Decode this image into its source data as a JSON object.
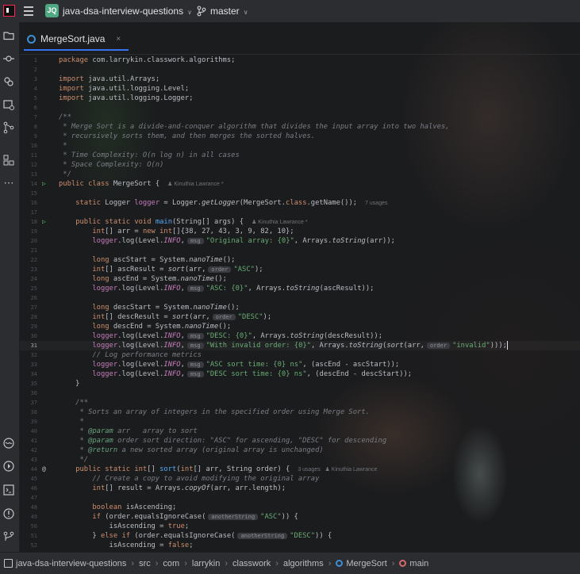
{
  "titlebar": {
    "project_badge": "JQ",
    "project_name": "java-dsa-interview-questions",
    "branch": "master"
  },
  "tab": {
    "label": "MergeSort.java",
    "close": "×"
  },
  "lines": [
    {
      "n": "1",
      "t": [
        [
          "k",
          "package "
        ],
        [
          "",
          "com.larrykin.classwork.algorithms;"
        ]
      ]
    },
    {
      "n": "2",
      "t": []
    },
    {
      "n": "3",
      "t": [
        [
          "k",
          "import "
        ],
        [
          "",
          "java.util.Arrays;"
        ]
      ]
    },
    {
      "n": "4",
      "t": [
        [
          "k",
          "import "
        ],
        [
          "",
          "java.util.logging.Level;"
        ]
      ]
    },
    {
      "n": "5",
      "t": [
        [
          "k",
          "import "
        ],
        [
          "",
          "java.util.logging.Logger;"
        ]
      ]
    },
    {
      "n": "6",
      "t": []
    },
    {
      "n": "7",
      "t": [
        [
          "c",
          "/**"
        ]
      ]
    },
    {
      "n": "8",
      "t": [
        [
          "c",
          " * Merge Sort is a divide-and-conquer algorithm that divides the input array into two halves,"
        ]
      ]
    },
    {
      "n": "9",
      "t": [
        [
          "c",
          " * recursively sorts them, and then merges the sorted halves."
        ]
      ]
    },
    {
      "n": "10",
      "t": [
        [
          "c",
          " * "
        ]
      ]
    },
    {
      "n": "11",
      "t": [
        [
          "c",
          " * Time Complexity: O(n log n) in all cases"
        ]
      ]
    },
    {
      "n": "12",
      "t": [
        [
          "c",
          " * Space Complexity: O(n)"
        ]
      ]
    },
    {
      "n": "13",
      "t": [
        [
          "c",
          " */"
        ]
      ]
    },
    {
      "n": "14",
      "g": "▷",
      "t": [
        [
          "k",
          "public class "
        ],
        [
          "",
          "MergeSort {"
        ],
        [
          "anno",
          "♟ Kinuthia Lawrance *"
        ]
      ]
    },
    {
      "n": "15",
      "t": []
    },
    {
      "n": "16",
      "t": [
        [
          "",
          "    "
        ],
        [
          "k",
          "static "
        ],
        [
          "",
          "Logger "
        ],
        [
          "fi",
          "logger"
        ],
        [
          "",
          " = Logger."
        ],
        [
          "st",
          "getLogger"
        ],
        [
          "",
          "(MergeSort."
        ],
        [
          "k",
          "class"
        ],
        [
          "",
          ".getName());"
        ],
        [
          "anno",
          "7 usages"
        ]
      ]
    },
    {
      "n": "17",
      "t": []
    },
    {
      "n": "18",
      "g": "▷",
      "t": [
        [
          "",
          "    "
        ],
        [
          "k",
          "public static void "
        ],
        [
          "f",
          "main"
        ],
        [
          "",
          "(String[] args) {"
        ],
        [
          "anno",
          "♟ Kinuthia Lawrance *"
        ]
      ]
    },
    {
      "n": "19",
      "t": [
        [
          "",
          "        "
        ],
        [
          "k",
          "int"
        ],
        [
          "",
          "[] arr = "
        ],
        [
          "k",
          "new int"
        ],
        [
          "",
          "[]{38, 27, 43, 3, 9, 82, 10};"
        ]
      ]
    },
    {
      "n": "20",
      "t": [
        [
          "",
          "        "
        ],
        [
          "fi",
          "logger"
        ],
        [
          "",
          ".log(Level."
        ],
        [
          "fi st",
          "INFO"
        ],
        [
          ",",
          ""
        ],
        [
          "hint",
          "msg"
        ],
        [
          "s",
          "\"Original array: {0}\""
        ],
        [
          "",
          ", Arrays."
        ],
        [
          "st",
          "toString"
        ],
        [
          "",
          "(arr));"
        ]
      ]
    },
    {
      "n": "21",
      "t": []
    },
    {
      "n": "22",
      "t": [
        [
          "",
          "        "
        ],
        [
          "k",
          "long "
        ],
        [
          "",
          "ascStart = System."
        ],
        [
          "st",
          "nanoTime"
        ],
        [
          "",
          "();"
        ]
      ]
    },
    {
      "n": "23",
      "t": [
        [
          "",
          "        "
        ],
        [
          "k",
          "int"
        ],
        [
          "",
          "[] ascResult = "
        ],
        [
          "st",
          "sort"
        ],
        [
          "",
          "(arr,"
        ],
        [
          "hint",
          "order"
        ],
        [
          "s",
          "\"ASC\""
        ],
        [
          "",
          ");"
        ]
      ]
    },
    {
      "n": "24",
      "t": [
        [
          "",
          "        "
        ],
        [
          "k",
          "long "
        ],
        [
          "",
          "ascEnd = System."
        ],
        [
          "st",
          "nanoTime"
        ],
        [
          "",
          "();"
        ]
      ]
    },
    {
      "n": "25",
      "t": [
        [
          "",
          "        "
        ],
        [
          "fi",
          "logger"
        ],
        [
          "",
          ".log(Level."
        ],
        [
          "fi st",
          "INFO"
        ],
        [
          ",",
          ""
        ],
        [
          "hint",
          "msg"
        ],
        [
          "s",
          "\"ASC: {0}\""
        ],
        [
          "",
          ", Arrays."
        ],
        [
          "st",
          "toString"
        ],
        [
          "",
          "(ascResult));"
        ]
      ]
    },
    {
      "n": "26",
      "t": []
    },
    {
      "n": "27",
      "t": [
        [
          "",
          "        "
        ],
        [
          "k",
          "long "
        ],
        [
          "",
          "descStart = System."
        ],
        [
          "st",
          "nanoTime"
        ],
        [
          "",
          "();"
        ]
      ]
    },
    {
      "n": "28",
      "t": [
        [
          "",
          "        "
        ],
        [
          "k",
          "int"
        ],
        [
          "",
          "[] descResult = "
        ],
        [
          "st",
          "sort"
        ],
        [
          "",
          "(arr,"
        ],
        [
          "hint",
          "order"
        ],
        [
          "s",
          "\"DESC\""
        ],
        [
          "",
          ");"
        ]
      ]
    },
    {
      "n": "29",
      "t": [
        [
          "",
          "        "
        ],
        [
          "k",
          "long "
        ],
        [
          "",
          "descEnd = System."
        ],
        [
          "st",
          "nanoTime"
        ],
        [
          "",
          "();"
        ]
      ]
    },
    {
      "n": "30",
      "t": [
        [
          "",
          "        "
        ],
        [
          "fi",
          "logger"
        ],
        [
          "",
          ".log(Level."
        ],
        [
          "fi st",
          "INFO"
        ],
        [
          ",",
          ""
        ],
        [
          "hint",
          "msg"
        ],
        [
          "s",
          "\"DESC: {0}\""
        ],
        [
          "",
          ", Arrays."
        ],
        [
          "st",
          "toString"
        ],
        [
          "",
          "(descResult));"
        ]
      ]
    },
    {
      "n": "31",
      "cur": true,
      "t": [
        [
          "",
          "        "
        ],
        [
          "fi",
          "logger"
        ],
        [
          "",
          ".log(Level."
        ],
        [
          "fi st",
          "INFO"
        ],
        [
          ",",
          ""
        ],
        [
          "hint",
          "msg"
        ],
        [
          "s",
          "\"With invalid order: {0}\""
        ],
        [
          "",
          ", Arrays."
        ],
        [
          "st",
          "toString"
        ],
        [
          "",
          "("
        ],
        [
          "st",
          "sort"
        ],
        [
          "",
          "(arr,"
        ],
        [
          "hint",
          "order"
        ],
        [
          "s",
          "\"invalid\""
        ],
        [
          "",
          ")));"
        ],
        [
          "caret",
          ""
        ]
      ]
    },
    {
      "n": "32",
      "t": [
        [
          "c",
          "        // Log performance metrics"
        ]
      ]
    },
    {
      "n": "33",
      "t": [
        [
          "",
          "        "
        ],
        [
          "fi",
          "logger"
        ],
        [
          "",
          ".log(Level."
        ],
        [
          "fi st",
          "INFO"
        ],
        [
          ",",
          ""
        ],
        [
          "hint",
          "msg"
        ],
        [
          "s",
          "\"ASC sort time: {0} ns\""
        ],
        [
          "",
          ", (ascEnd - ascStart));"
        ]
      ]
    },
    {
      "n": "34",
      "t": [
        [
          "",
          "        "
        ],
        [
          "fi",
          "logger"
        ],
        [
          "",
          ".log(Level."
        ],
        [
          "fi st",
          "INFO"
        ],
        [
          ",",
          ""
        ],
        [
          "hint",
          "msg"
        ],
        [
          "s",
          "\"DESC sort time: {0} ns\""
        ],
        [
          "",
          ", (descEnd - descStart));"
        ]
      ]
    },
    {
      "n": "35",
      "t": [
        [
          "",
          "    }"
        ]
      ]
    },
    {
      "n": "36",
      "t": []
    },
    {
      "n": "37",
      "t": [
        [
          "c",
          "    /**"
        ]
      ]
    },
    {
      "n": "38",
      "t": [
        [
          "c",
          "     * Sorts an array of integers in the specified order using Merge Sort."
        ]
      ]
    },
    {
      "n": "39",
      "t": [
        [
          "c",
          "     *"
        ]
      ]
    },
    {
      "n": "40",
      "t": [
        [
          "c",
          "     * "
        ],
        [
          "tg",
          "@param"
        ],
        [
          "c",
          " arr   array to sort"
        ]
      ]
    },
    {
      "n": "41",
      "t": [
        [
          "c",
          "     * "
        ],
        [
          "tg",
          "@param"
        ],
        [
          "c",
          " order sort direction: \"ASC\" for ascending, \"DESC\" for descending"
        ]
      ]
    },
    {
      "n": "42",
      "t": [
        [
          "c",
          "     * "
        ],
        [
          "tg",
          "@return"
        ],
        [
          "c",
          " a new sorted array (original array is unchanged)"
        ]
      ]
    },
    {
      "n": "43",
      "t": [
        [
          "c",
          "     */"
        ]
      ]
    },
    {
      "n": "44",
      "g": "@",
      "t": [
        [
          "",
          "    "
        ],
        [
          "k",
          "public static int"
        ],
        [
          "",
          "[] "
        ],
        [
          "f",
          "sort"
        ],
        [
          "",
          "("
        ],
        [
          "k",
          "int"
        ],
        [
          "",
          "[] arr, String order) {"
        ],
        [
          "anno",
          "3 usages   ♟ Kinuthia Lawrance"
        ]
      ]
    },
    {
      "n": "45",
      "t": [
        [
          "c",
          "        // Create a copy to avoid modifying the original array"
        ]
      ]
    },
    {
      "n": "46",
      "t": [
        [
          "",
          "        "
        ],
        [
          "k",
          "int"
        ],
        [
          "",
          "[] result = Arrays."
        ],
        [
          "st",
          "copyOf"
        ],
        [
          "",
          "(arr, arr.length);"
        ]
      ]
    },
    {
      "n": "47",
      "t": []
    },
    {
      "n": "48",
      "t": [
        [
          "",
          "        "
        ],
        [
          "k",
          "boolean "
        ],
        [
          "",
          "isAscending;"
        ]
      ]
    },
    {
      "n": "49",
      "t": [
        [
          "",
          "        "
        ],
        [
          "k",
          "if "
        ],
        [
          "",
          "(order.equalsIgnoreCase("
        ],
        [
          "hint",
          "anotherString"
        ],
        [
          "s",
          "\"ASC\""
        ],
        [
          "",
          ")) {"
        ]
      ]
    },
    {
      "n": "50",
      "t": [
        [
          "",
          "            isAscending = "
        ],
        [
          "k",
          "true"
        ],
        [
          "",
          ";"
        ]
      ]
    },
    {
      "n": "51",
      "t": [
        [
          "",
          "        } "
        ],
        [
          "k",
          "else if "
        ],
        [
          "",
          "(order.equalsIgnoreCase("
        ],
        [
          "hint",
          "anotherString"
        ],
        [
          "s",
          "\"DESC\""
        ],
        [
          "",
          ")) {"
        ]
      ]
    },
    {
      "n": "52",
      "t": [
        [
          "",
          "            isAscending = "
        ],
        [
          "k",
          "false"
        ],
        [
          "",
          ";"
        ]
      ]
    }
  ],
  "breadcrumbs": [
    {
      "label": "java-dsa-interview-questions",
      "icon": "folder-icon"
    },
    {
      "label": "src",
      "icon": ""
    },
    {
      "label": "com",
      "icon": ""
    },
    {
      "label": "larrykin",
      "icon": ""
    },
    {
      "label": "classwork",
      "icon": ""
    },
    {
      "label": "algorithms",
      "icon": ""
    },
    {
      "label": "MergeSort",
      "icon": "class-icon"
    },
    {
      "label": "main",
      "icon": "method-icon"
    }
  ],
  "colors": {
    "accent": "#3574f0",
    "keyword": "#cf8e6d",
    "string": "#6aab73",
    "comment": "#7a7e85",
    "function": "#56a8f5",
    "field": "#c77dbb"
  }
}
